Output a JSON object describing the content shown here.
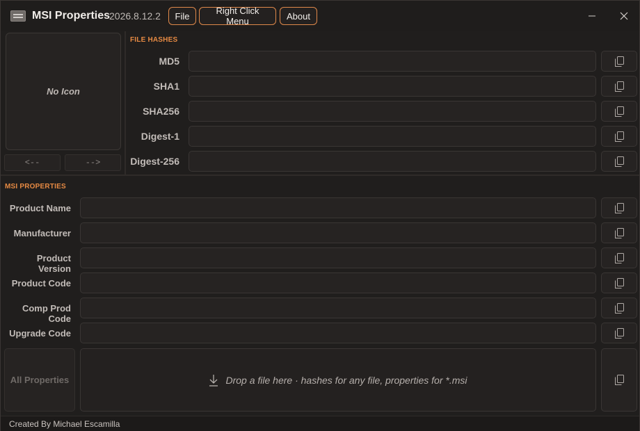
{
  "app": {
    "title": "MSI Properties",
    "version": "2026.8.12.2"
  },
  "menu": {
    "file": "File",
    "right_click_menu": "Right Click Menu",
    "about": "About"
  },
  "window_controls": {
    "minimize": "—",
    "close": "✕"
  },
  "icon_panel": {
    "placeholder": "No Icon",
    "prev_label": "<--",
    "next_label": "-->"
  },
  "file_hashes": {
    "section_label": "FILE HASHES",
    "fields": [
      {
        "label": "MD5",
        "value": ""
      },
      {
        "label": "SHA1",
        "value": ""
      },
      {
        "label": "SHA256",
        "value": ""
      },
      {
        "label": "Digest-1",
        "value": ""
      },
      {
        "label": "Digest-256",
        "value": ""
      }
    ]
  },
  "msi_properties": {
    "section_label": "MSI PROPERTIES",
    "fields": [
      {
        "label": "Product Name",
        "value": ""
      },
      {
        "label": "Manufacturer",
        "value": ""
      },
      {
        "label": "Product Version",
        "value": ""
      },
      {
        "label": "Product Code",
        "value": ""
      },
      {
        "label": "Comp Prod Code",
        "value": ""
      },
      {
        "label": "Upgrade Code",
        "value": ""
      }
    ],
    "all_properties_label": "All Properties",
    "drop_hint": "Drop a file here · hashes for any file, properties for *.msi"
  },
  "status_bar": {
    "text": "Created By Michael Escamilla"
  },
  "colors": {
    "accent": "#e68a43",
    "button_border": "#e0894a",
    "background": "#201e1d",
    "field_bg": "#262322"
  },
  "icons": {
    "app": "window-icon",
    "copy": "copy-icon",
    "drop": "download-arrow-icon",
    "minimize": "minimize-icon",
    "close": "close-icon"
  }
}
